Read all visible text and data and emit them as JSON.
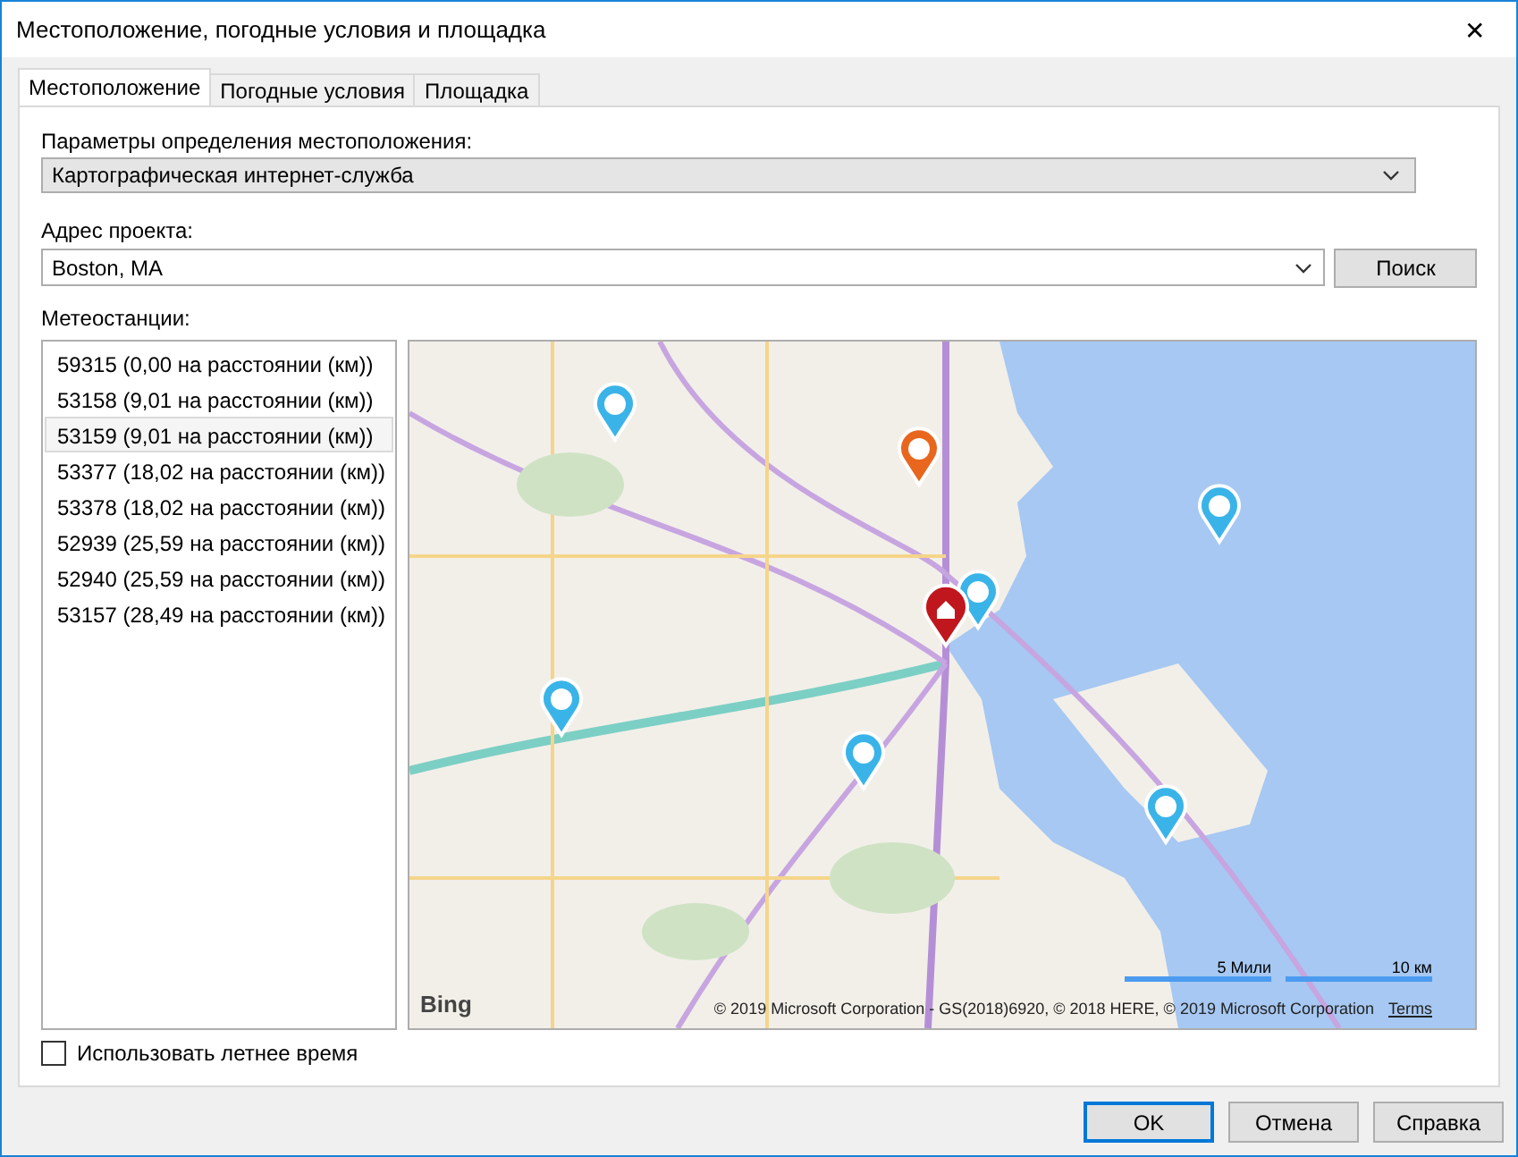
{
  "window": {
    "title": "Местоположение, погодные условия и площадка",
    "close": "✕"
  },
  "tabs": [
    {
      "label": "Местоположение",
      "selected": true
    },
    {
      "label": "Погодные условия",
      "selected": false
    },
    {
      "label": "Площадка",
      "selected": false
    }
  ],
  "location_mode": {
    "label": "Параметры определения местоположения:",
    "value": "Картографическая интернет-служба"
  },
  "address": {
    "label": "Адрес проекта:",
    "value": "Boston, MA",
    "search_button": "Поиск"
  },
  "stations": {
    "label": "Метеостанции:",
    "items": [
      {
        "text": "59315 (0,00 на расстоянии (км))",
        "selected": false
      },
      {
        "text": "53158 (9,01 на расстоянии (км))",
        "selected": false
      },
      {
        "text": "53159 (9,01 на расстоянии (км))",
        "selected": true
      },
      {
        "text": "53377 (18,02 на расстоянии (км))",
        "selected": false
      },
      {
        "text": "53378 (18,02 на расстоянии (км))",
        "selected": false
      },
      {
        "text": "52939 (25,59 на расстоянии (км))",
        "selected": false
      },
      {
        "text": "52940 (25,59 на расстоянии (км))",
        "selected": false
      },
      {
        "text": "53157 (28,49 на расстоянии (км))",
        "selected": false
      }
    ]
  },
  "map": {
    "logo": "Bing",
    "scale_miles": "5 Мили",
    "scale_km": "10 км",
    "attribution": "© 2019 Microsoft Corporation - GS(2018)6920, © 2018 HERE, © 2019 Microsoft Corporation",
    "terms": "Terms"
  },
  "daylight_saving": {
    "label": "Использовать летнее время",
    "checked": false
  },
  "buttons": [
    {
      "label": "OK",
      "default": true
    },
    {
      "label": "Отмена",
      "default": false
    },
    {
      "label": "Справка",
      "default": false
    }
  ]
}
